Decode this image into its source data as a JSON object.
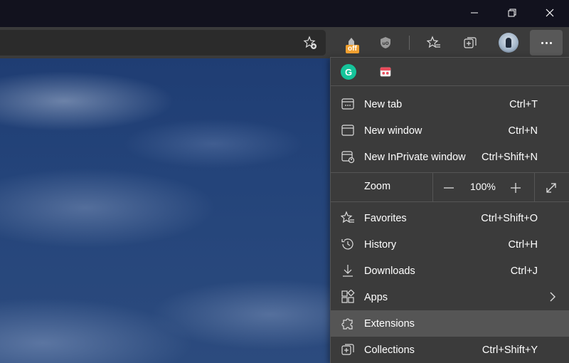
{
  "window": {
    "minimize_icon": "minimize-icon",
    "restore_icon": "restore-icon",
    "close_icon": "close-icon"
  },
  "toolbar": {
    "favorite_add_icon": "star-plus-icon",
    "extension_badge": "off",
    "more_icon": "more-dots-icon"
  },
  "menu": {
    "extensions_row": [
      {
        "name": "grammarly",
        "glyph": "G",
        "color": "#15c39a"
      },
      {
        "name": "pdf-extension",
        "color": "#e94b5b"
      }
    ],
    "new_tab": {
      "label": "New tab",
      "shortcut": "Ctrl+T"
    },
    "new_window": {
      "label": "New window",
      "shortcut": "Ctrl+N"
    },
    "new_inprivate": {
      "label": "New InPrivate window",
      "shortcut": "Ctrl+Shift+N"
    },
    "zoom": {
      "label": "Zoom",
      "value": "100%",
      "minus": "−",
      "plus": "+"
    },
    "favorites": {
      "label": "Favorites",
      "shortcut": "Ctrl+Shift+O"
    },
    "history": {
      "label": "History",
      "shortcut": "Ctrl+H"
    },
    "downloads": {
      "label": "Downloads",
      "shortcut": "Ctrl+J"
    },
    "apps": {
      "label": "Apps"
    },
    "extensions": {
      "label": "Extensions"
    },
    "collections": {
      "label": "Collections",
      "shortcut": "Ctrl+Shift+Y"
    }
  },
  "colors": {
    "menu_bg": "#3b3b3b",
    "highlight": "#555555",
    "titlebar": "#12121e"
  }
}
